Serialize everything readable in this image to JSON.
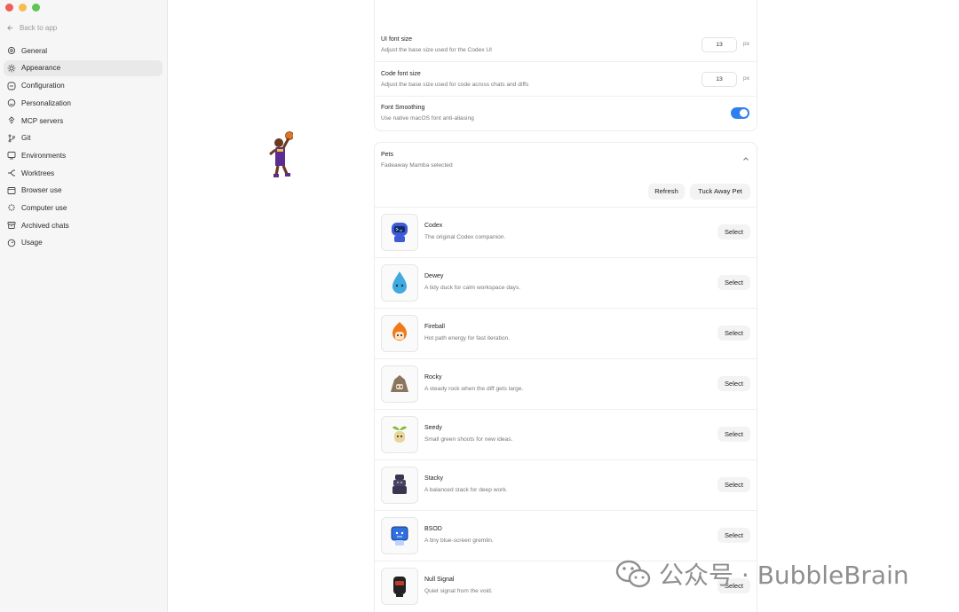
{
  "sidebar": {
    "back_label": "Back to app",
    "items": [
      {
        "label": "General",
        "icon": "gear-icon"
      },
      {
        "label": "Appearance",
        "icon": "sun-icon"
      },
      {
        "label": "Configuration",
        "icon": "sliders-icon"
      },
      {
        "label": "Personalization",
        "icon": "smile-icon"
      },
      {
        "label": "MCP servers",
        "icon": "plug-icon"
      },
      {
        "label": "Git",
        "icon": "branch-icon"
      },
      {
        "label": "Environments",
        "icon": "monitor-icon"
      },
      {
        "label": "Worktrees",
        "icon": "fork-icon"
      },
      {
        "label": "Browser use",
        "icon": "browser-icon"
      },
      {
        "label": "Computer use",
        "icon": "sparkle-icon"
      },
      {
        "label": "Archived chats",
        "icon": "archive-icon"
      },
      {
        "label": "Usage",
        "icon": "gauge-icon"
      }
    ],
    "active": "Appearance"
  },
  "appearance": {
    "ui_font": {
      "title": "UI font size",
      "desc": "Adjust the base size used for the Codex UI",
      "value": "13",
      "unit": "px"
    },
    "code_font": {
      "title": "Code font size",
      "desc": "Adjust the base size used for code across chats and diffs",
      "value": "13",
      "unit": "px"
    },
    "smoothing": {
      "title": "Font Smoothing",
      "desc": "Use native macOS font anti-aliasing",
      "enabled": true
    }
  },
  "pets": {
    "title": "Pets",
    "selected_desc": "Fadeaway Mamba selected",
    "refresh_label": "Refresh",
    "tuck_label": "Tuck Away Pet",
    "items": [
      {
        "name": "Codex",
        "desc": "The original Codex companion.",
        "select": "Select"
      },
      {
        "name": "Dewey",
        "desc": "A tidy duck for calm workspace days.",
        "select": "Select"
      },
      {
        "name": "Fireball",
        "desc": "Hot path energy for fast iteration.",
        "select": "Select"
      },
      {
        "name": "Rocky",
        "desc": "A steady rock when the diff gets large.",
        "select": "Select"
      },
      {
        "name": "Seedy",
        "desc": "Small green shoots for new ideas.",
        "select": "Select"
      },
      {
        "name": "Stacky",
        "desc": "A balanced stack for deep work.",
        "select": "Select"
      },
      {
        "name": "BSOD",
        "desc": "A tiny blue-screen gremlin.",
        "select": "Select"
      },
      {
        "name": "Null Signal",
        "desc": "Quiet signal from the void.",
        "select": "Select"
      }
    ]
  },
  "watermark": {
    "text": "公众号 · BubbleBrain"
  },
  "colors": {
    "accent": "#2f80ed",
    "sidebar_bg": "#f6f6f6"
  }
}
